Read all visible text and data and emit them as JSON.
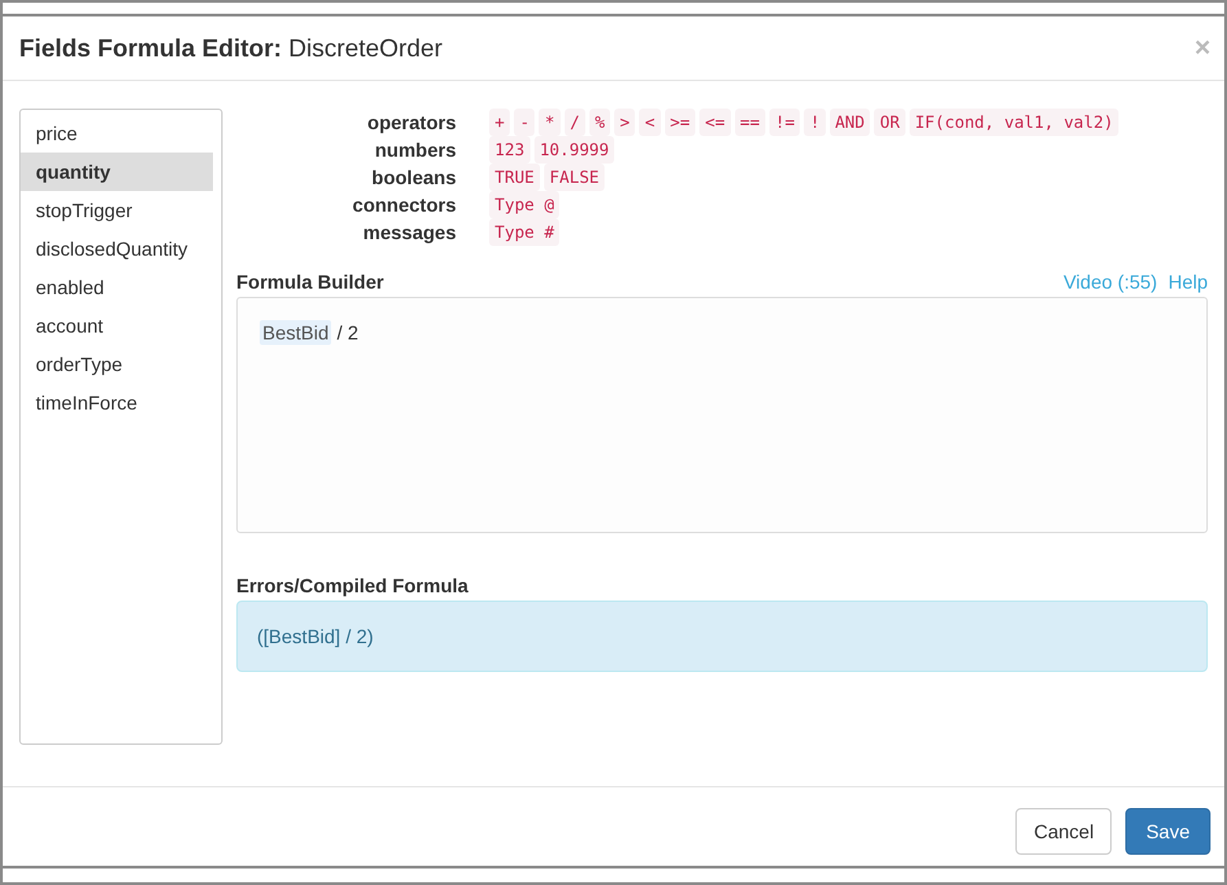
{
  "window": {
    "title": "**Fields Formula Editor:** DiscreteOrder",
    "close": "×"
  },
  "sidebar": {
    "items": [
      {
        "label": "price",
        "selected": false
      },
      {
        "label": "quantity",
        "selected": true
      },
      {
        "label": "stopTrigger",
        "selected": false
      },
      {
        "label": "disclosedQuantity",
        "selected": false
      },
      {
        "label": "enabled",
        "selected": false
      },
      {
        "label": "account",
        "selected": false
      },
      {
        "label": "orderType",
        "selected": false
      },
      {
        "label": "timeInForce",
        "selected": false
      }
    ]
  },
  "reference": [
    {
      "label": "operators",
      "tokens": [
        "+",
        "-",
        "*",
        "/",
        "%",
        ">",
        "<",
        ">=",
        "<=",
        "==",
        "!=",
        "!",
        "AND",
        "OR",
        "IF(cond, val1, val2)"
      ]
    },
    {
      "label": "numbers",
      "tokens": [
        "123",
        "10.9999"
      ]
    },
    {
      "label": "booleans",
      "tokens": [
        "TRUE",
        "FALSE"
      ]
    },
    {
      "label": "connectors",
      "tokens": [
        "Type @"
      ]
    },
    {
      "label": "messages",
      "tokens": [
        "Type #"
      ]
    }
  ],
  "builder": {
    "title": "Formula Builder",
    "links": [
      "Video (:55)",
      "Help"
    ],
    "formula": [
      {
        "kind": "field",
        "text": "BestBid"
      },
      {
        "kind": "text",
        "text": "/ 2"
      }
    ]
  },
  "compiled": {
    "title": "Errors/Compiled Formula",
    "text": "([BestBid] / 2)"
  },
  "buttons": [
    {
      "label": "Cancel",
      "kind": "default"
    },
    {
      "label": "Save",
      "kind": "primary"
    }
  ]
}
